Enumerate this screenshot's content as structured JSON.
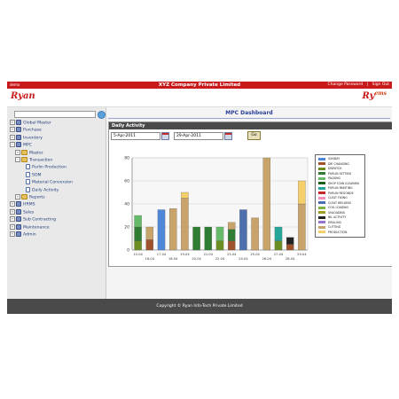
{
  "topbar": {
    "user": "demo",
    "title": "XYZ Company Private Limited",
    "change_password": "Change Password",
    "separator": "|",
    "sign_out": "Sign Out"
  },
  "header": {
    "logo_left": "Ryan",
    "logo_right": "Ry",
    "logo_right_suffix": "ems"
  },
  "sidebar": {
    "search_placeholder": "",
    "tree": [
      {
        "label": "Global Master",
        "expander": "+",
        "icon": "gear-icon",
        "depth": 0
      },
      {
        "label": "Purchase",
        "expander": "+",
        "icon": "gear-icon",
        "depth": 0
      },
      {
        "label": "Inventory",
        "expander": "+",
        "icon": "gear-icon",
        "depth": 0
      },
      {
        "label": "MPC",
        "expander": "−",
        "icon": "gear-icon",
        "depth": 0
      },
      {
        "label": "Master",
        "expander": "+",
        "icon": "folder-icon",
        "depth": 1
      },
      {
        "label": "Transaction",
        "expander": "−",
        "icon": "folder-icon",
        "depth": 1
      },
      {
        "label": "Purlin Production",
        "expander": "",
        "icon": "document-icon",
        "depth": 2
      },
      {
        "label": "SOM",
        "expander": "",
        "icon": "document-icon",
        "depth": 2
      },
      {
        "label": "Material Conversion",
        "expander": "",
        "icon": "document-icon",
        "depth": 2
      },
      {
        "label": "Daily Activity",
        "expander": "",
        "icon": "document-icon",
        "depth": 2
      },
      {
        "label": "Reports",
        "expander": "+",
        "icon": "folder-icon",
        "depth": 1
      },
      {
        "label": "HRMS",
        "expander": "+",
        "icon": "gear-icon",
        "depth": 0
      },
      {
        "label": "Sales",
        "expander": "+",
        "icon": "gear-icon",
        "depth": 0
      },
      {
        "label": "Sub Contracting",
        "expander": "+",
        "icon": "gear-icon",
        "depth": 0
      },
      {
        "label": "Maintenance",
        "expander": "+",
        "icon": "gear-icon",
        "depth": 0
      },
      {
        "label": "Admin",
        "expander": "+",
        "icon": "gear-icon",
        "depth": 0
      }
    ]
  },
  "main": {
    "title": "MPC Dashboard",
    "panel_title": "Daily Activity",
    "from_date": "5-Apr-2011",
    "to_date": "29-Apr-2011",
    "go_label": "Go"
  },
  "chart_data": {
    "type": "bar",
    "stacked": true,
    "categories": [
      "15-04",
      "16-04",
      "17-04",
      "18-04",
      "19-04",
      "20-04",
      "21-04",
      "22-04",
      "23-04",
      "24-04",
      "25-04",
      "26-04",
      "27-04",
      "28-04",
      "29-04"
    ],
    "ylim": [
      0,
      80
    ],
    "yticks": [
      0,
      20,
      40,
      60,
      80
    ],
    "grid": true,
    "legend_position": "right",
    "series": [
      {
        "name": "SUNDAY",
        "color": "#4f86d8",
        "values": [
          0,
          0,
          35,
          0,
          0,
          0,
          0,
          0,
          0,
          0,
          0,
          0,
          0,
          0,
          0
        ]
      },
      {
        "name": "DIE CHANGING",
        "color": "#a0522d",
        "values": [
          0,
          9,
          0,
          0,
          0,
          0,
          0,
          0,
          8,
          0,
          0,
          0,
          0,
          5,
          0
        ]
      },
      {
        "name": "DISPATCH",
        "color": "#6b8e23",
        "values": [
          8,
          0,
          0,
          0,
          0,
          0,
          0,
          8,
          0,
          0,
          0,
          0,
          8,
          0,
          0
        ]
      },
      {
        "name": "PURLIN SETTING",
        "color": "#2e7d32",
        "values": [
          12,
          0,
          0,
          0,
          0,
          20,
          20,
          0,
          10,
          0,
          0,
          0,
          0,
          0,
          0
        ]
      },
      {
        "name": "PACKING",
        "color": "#66bb6a",
        "values": [
          10,
          0,
          0,
          0,
          0,
          0,
          0,
          12,
          0,
          0,
          0,
          0,
          0,
          0,
          0
        ]
      },
      {
        "name": "SHOP F.DIN CLEANING",
        "color": "#1b5e20",
        "values": [
          0,
          0,
          0,
          0,
          0,
          0,
          0,
          0,
          0,
          0,
          0,
          0,
          0,
          0,
          0
        ]
      },
      {
        "name": "PURLIN PAINTING",
        "color": "#26a69a",
        "values": [
          0,
          0,
          0,
          0,
          0,
          0,
          0,
          0,
          0,
          0,
          0,
          0,
          12,
          0,
          0
        ]
      },
      {
        "name": "PURLIN REGONDE",
        "color": "#c62828",
        "values": [
          0,
          0,
          0,
          0,
          0,
          0,
          0,
          0,
          0,
          0,
          0,
          0,
          0,
          0,
          0
        ]
      },
      {
        "name": "CLEAT FIXING",
        "color": "#f48fb1",
        "values": [
          0,
          0,
          0,
          0,
          0,
          0,
          0,
          0,
          0,
          0,
          0,
          0,
          0,
          0,
          0
        ]
      },
      {
        "name": "CLEAT WELDING",
        "color": "#4e6fae",
        "values": [
          0,
          0,
          0,
          0,
          0,
          0,
          0,
          0,
          0,
          35,
          0,
          0,
          0,
          0,
          0
        ]
      },
      {
        "name": "COIL LOADING",
        "color": "#7cb342",
        "values": [
          0,
          0,
          0,
          0,
          0,
          0,
          0,
          0,
          0,
          0,
          0,
          0,
          0,
          0,
          0
        ]
      },
      {
        "name": "UNLOADING",
        "color": "#9e9d24",
        "values": [
          0,
          0,
          0,
          0,
          0,
          0,
          0,
          0,
          0,
          0,
          0,
          0,
          0,
          0,
          0
        ]
      },
      {
        "name": "NIL ACTIVITY",
        "color": "#222222",
        "values": [
          0,
          0,
          0,
          0,
          0,
          0,
          0,
          0,
          0,
          0,
          0,
          0,
          0,
          6,
          0
        ]
      },
      {
        "name": "DRILLING",
        "color": "#9575cd",
        "values": [
          0,
          0,
          0,
          0,
          0,
          0,
          0,
          0,
          0,
          0,
          0,
          0,
          0,
          0,
          0
        ]
      },
      {
        "name": "CUTTING",
        "color": "#c8a46a",
        "values": [
          0,
          11,
          0,
          36,
          45,
          0,
          0,
          0,
          6,
          0,
          28,
          80,
          0,
          0,
          40
        ]
      },
      {
        "name": "PRODUCTION",
        "color": "#f5cf6a",
        "values": [
          0,
          0,
          0,
          0,
          5,
          0,
          0,
          0,
          0,
          0,
          0,
          0,
          0,
          0,
          20
        ]
      }
    ]
  },
  "footer": {
    "copyright": "Copyright © Ryan Info-Tech Private Limited"
  }
}
